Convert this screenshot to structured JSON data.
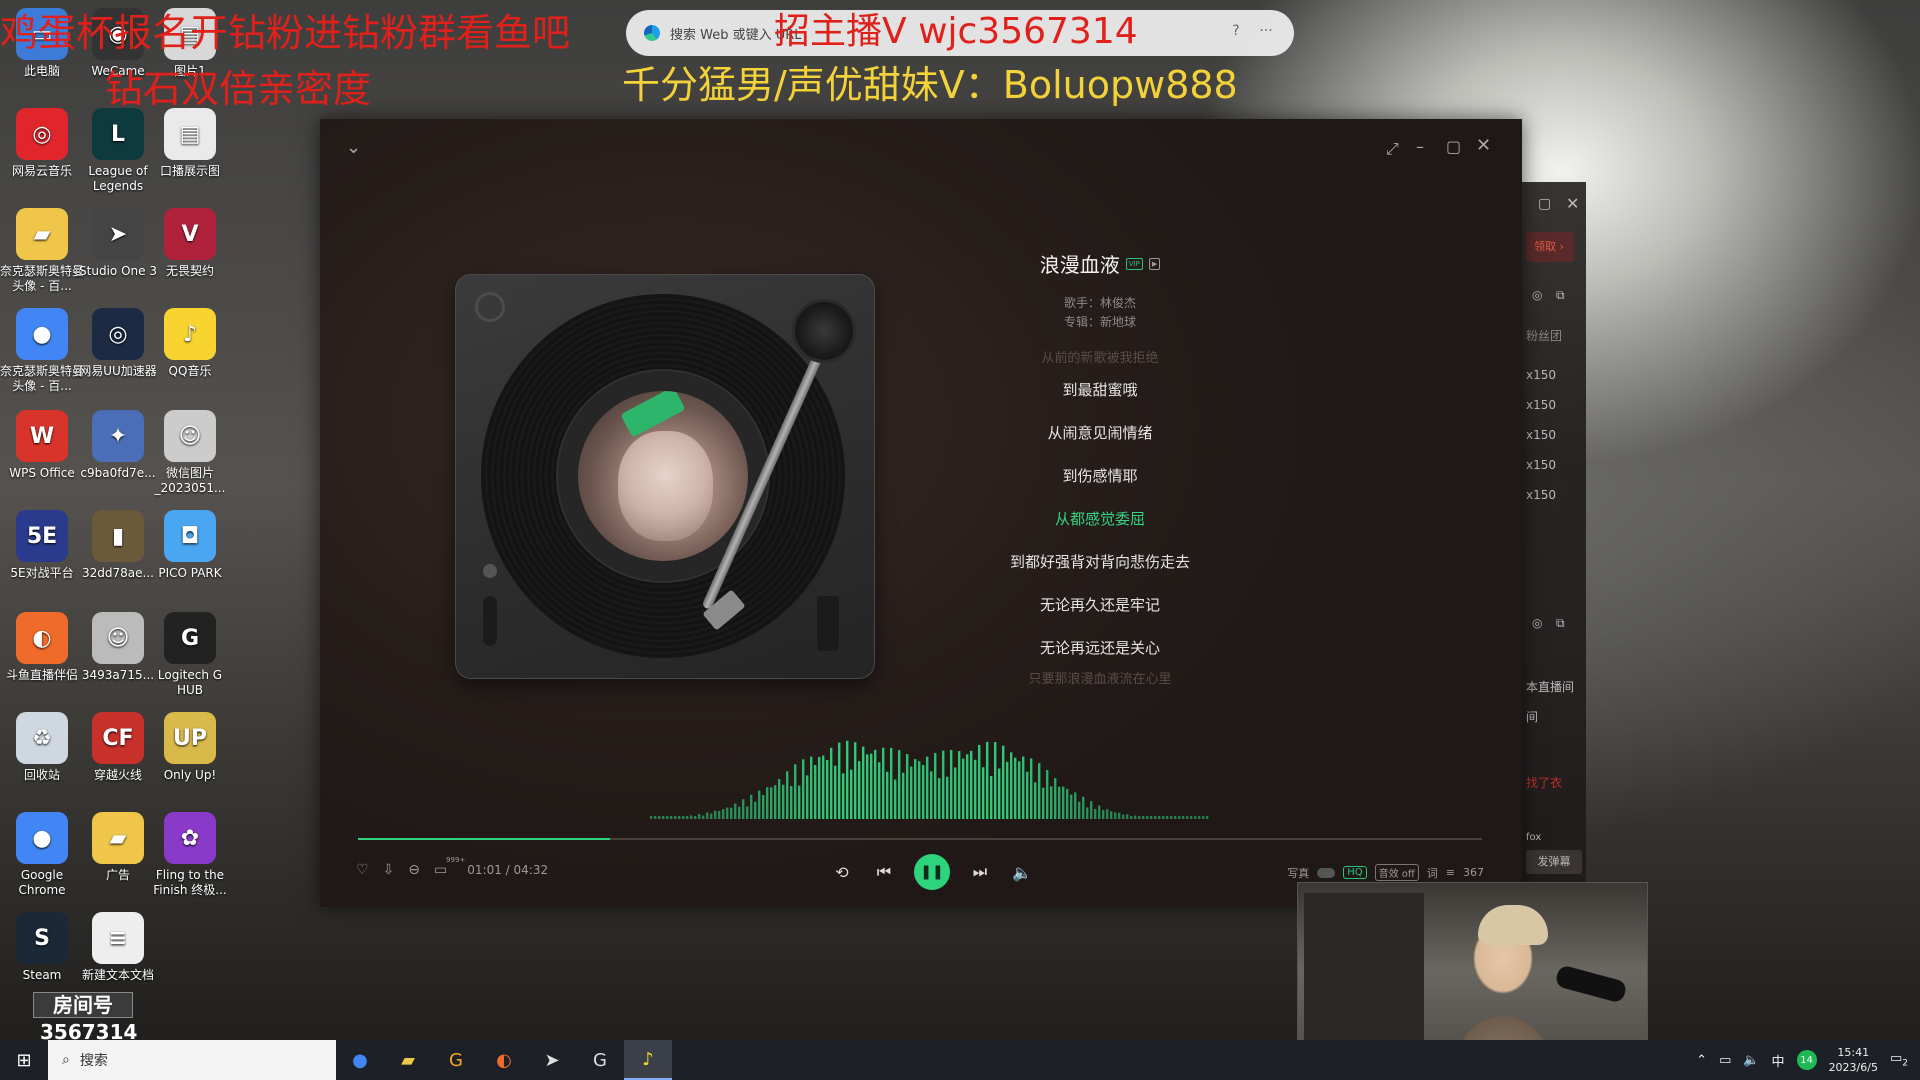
{
  "desktop": {
    "icons": [
      {
        "label": "此电脑",
        "glyph": "▭",
        "bg": "#3d7bd9"
      },
      {
        "label": "WeCame",
        "glyph": "◉",
        "bg": "#333"
      },
      {
        "label": "图片1",
        "glyph": "▤",
        "bg": "#d8d8d8"
      },
      {
        "label": "网易云音乐",
        "glyph": "◎",
        "bg": "#e0262b"
      },
      {
        "label": "League of Legends",
        "glyph": "L",
        "bg": "#0d3a3d"
      },
      {
        "label": "口播展示图",
        "glyph": "▤",
        "bg": "#eaeaea"
      },
      {
        "label": "奈克瑟斯奥特曼头像 - 百...",
        "glyph": "▰",
        "bg": "#f0c64a"
      },
      {
        "label": "Studio One 3",
        "glyph": "➤",
        "bg": "#444"
      },
      {
        "label": "无畏契约",
        "glyph": "V",
        "bg": "#b0223a"
      },
      {
        "label": "奈克瑟斯奥特曼头像 - 百...",
        "glyph": "●",
        "bg": "#4285f4"
      },
      {
        "label": "网易UU加速器",
        "glyph": "◎",
        "bg": "#1c2a44"
      },
      {
        "label": "QQ音乐",
        "glyph": "♪",
        "bg": "#f7d430"
      },
      {
        "label": "WPS Office",
        "glyph": "W",
        "bg": "#d9342b"
      },
      {
        "label": "c9ba0fd7e...",
        "glyph": "✦",
        "bg": "#4a6fb8"
      },
      {
        "label": "微信图片_2023051...",
        "glyph": "☺",
        "bg": "#ccc"
      },
      {
        "label": "5E对战平台",
        "glyph": "5E",
        "bg": "#2a3a8c"
      },
      {
        "label": "32dd78ae...",
        "glyph": "▮",
        "bg": "#6b5a3a"
      },
      {
        "label": "PICO PARK",
        "glyph": "◘",
        "bg": "#4aa6f0"
      },
      {
        "label": "斗鱼直播伴侣",
        "glyph": "◐",
        "bg": "#f06b2a"
      },
      {
        "label": "3493a715...",
        "glyph": "☺",
        "bg": "#bbb"
      },
      {
        "label": "Logitech G HUB",
        "glyph": "G",
        "bg": "#222"
      },
      {
        "label": "回收站",
        "glyph": "♻",
        "bg": "#cfd8e0"
      },
      {
        "label": "穿越火线",
        "glyph": "CF",
        "bg": "#c8302a"
      },
      {
        "label": "Only Up!",
        "glyph": "UP",
        "bg": "#d9b94a"
      },
      {
        "label": "Google Chrome",
        "glyph": "●",
        "bg": "#4285f4"
      },
      {
        "label": "广告",
        "glyph": "▰",
        "bg": "#f0c64a"
      },
      {
        "label": "Fling to the Finish 终极...",
        "glyph": "✿",
        "bg": "#8a3ac8"
      },
      {
        "label": "Steam",
        "glyph": "S",
        "bg": "#1b2838"
      },
      {
        "label": "新建文本文档",
        "glyph": "≡",
        "bg": "#eee"
      }
    ]
  },
  "overlays": {
    "red_line1": "鸡蛋杯报名开钻粉进钻粉群看鱼吧",
    "red_line2": "钻石双倍亲密度",
    "top_banner": "招主播V wjc3567314",
    "yellow_line": "千分猛男/声优甜妹V：Boluopw888"
  },
  "browser_search": {
    "placeholder": "搜索 Web 或键入 URL",
    "help_icon": "?",
    "more_icon": "···"
  },
  "player": {
    "song_title": "浪漫血液",
    "vip_badge": "VIP",
    "mv_badge": "▶",
    "artist_label": "歌手：林俊杰",
    "album_label": "专辑：新地球",
    "lyrics": [
      {
        "text": "从前的新歌被我拒绝",
        "state": "fade"
      },
      {
        "text": "到最甜蜜哦",
        "state": "normal"
      },
      {
        "text": "从闹意见闹情绪",
        "state": "normal"
      },
      {
        "text": "到伤感情耶",
        "state": "normal"
      },
      {
        "text": "从都感觉委屈",
        "state": "active"
      },
      {
        "text": "到都好强背对背向悲伤走去",
        "state": "normal"
      },
      {
        "text": "无论再久还是牢记",
        "state": "normal"
      },
      {
        "text": "无论再远还是关心",
        "state": "normal"
      },
      {
        "text": "只要那浪漫血液流在心里",
        "state": "fade"
      }
    ],
    "time": "01:01 / 04:32",
    "progress": 0.224,
    "comment_count": "999+",
    "quality_label": "HQ",
    "effect_label": "音效 off",
    "write_label": "写真",
    "lyric_label": "词",
    "playlist_count": "367",
    "accent_color": "#2fd27c"
  },
  "side_panel": {
    "claim_label": "领取 ›",
    "fan_group": "粉丝团",
    "rows": [
      "x150",
      "x150",
      "x150",
      "x150",
      "x150"
    ],
    "live_label": "本直播间",
    "room_label": "间",
    "danmaku_label": "发弹幕",
    "fox_label": "fox",
    "chat_label": "找了衣"
  },
  "stream": {
    "room_label": "房间号",
    "room_number": "3567314"
  },
  "taskbar": {
    "search_label": "搜索",
    "ime_label": "中",
    "tray_count": "14",
    "time": "15:41",
    "date": "2023/6/5",
    "notifications": "2"
  }
}
